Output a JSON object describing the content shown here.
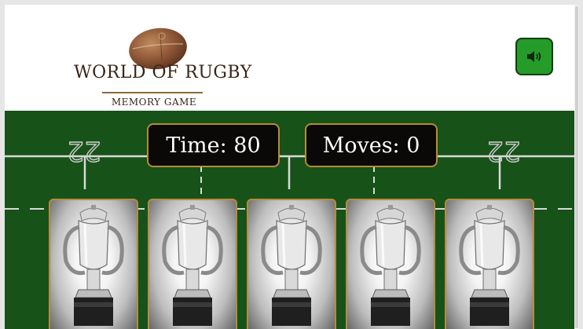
{
  "header": {
    "logo_title": "WORLD OF RUGBY",
    "logo_subtitle": "MEMORY GAME",
    "sound_icon": "volume-icon"
  },
  "stats": {
    "time_label": "Time: 80",
    "moves_label": "Moves: 0"
  },
  "field": {
    "marking_left": "22",
    "marking_right": "22"
  },
  "cards": [
    {
      "face": "trophy"
    },
    {
      "face": "trophy"
    },
    {
      "face": "trophy"
    },
    {
      "face": "trophy"
    },
    {
      "face": "trophy"
    }
  ],
  "colors": {
    "pitch": "#175219",
    "gold_border": "#b88b3a",
    "sound_button": "#259b2a"
  }
}
